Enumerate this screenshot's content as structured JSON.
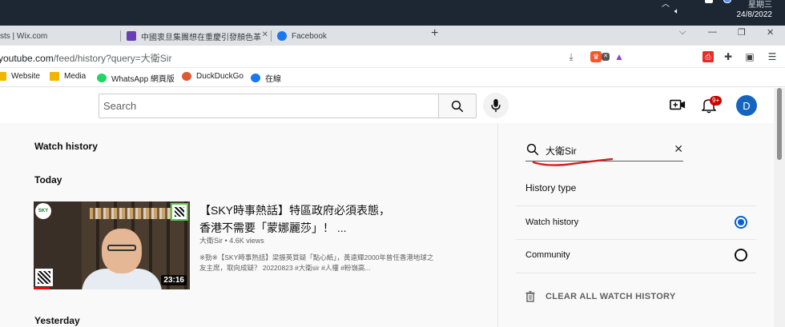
{
  "taskbar": {
    "day": "星期三",
    "date": "24/8/2022"
  },
  "tabs": [
    {
      "label": "sts | Wix.com"
    },
    {
      "label": "中國衷旦集團想在重慶引發顏色革命？"
    },
    {
      "label": "Facebook"
    }
  ],
  "address": {
    "host": "youtube.com",
    "path": "/feed/history?query=大衛Sir"
  },
  "bookmarks": [
    {
      "label": "Website",
      "icon": "folder-icon"
    },
    {
      "label": "Media",
      "icon": "folder-icon"
    },
    {
      "label": "WhatsApp 網頁版",
      "icon": "whatsapp-icon"
    },
    {
      "label": "DuckDuckGo",
      "icon": "duckduckgo-icon"
    },
    {
      "label": "在線",
      "icon": "facebook-icon"
    }
  ],
  "header": {
    "search_placeholder": "Search",
    "notification_count": "9+",
    "avatar_letter": "D"
  },
  "main": {
    "title": "Watch history",
    "section_today": "Today",
    "section_yesterday": "Yesterday",
    "video": {
      "title": "【SKY時事熱話】特區政府必須表態，香港不需要「蒙娜麗莎」！ ...",
      "channel": "大衛Sir",
      "views": "4.6K views",
      "description": "※勁※【SKY時事熱話】梁振英質疑「點心紙」，黃遠輝2000年曾任香港地球之友主席，取向成疑？ 20220823 #大衛sir #人權 #粉嶺高...",
      "duration": "23:16",
      "progress": 0.1
    }
  },
  "side": {
    "search_value": "大衛Sir",
    "history_type_label": "History type",
    "options": [
      {
        "label": "Watch history",
        "selected": true
      },
      {
        "label": "Community",
        "selected": false
      }
    ],
    "clear_all": "CLEAR ALL WATCH HISTORY"
  },
  "colors": {
    "accent": "#065fd4",
    "youtube_red": "#ff0000",
    "annotation_red": "#d32020"
  }
}
